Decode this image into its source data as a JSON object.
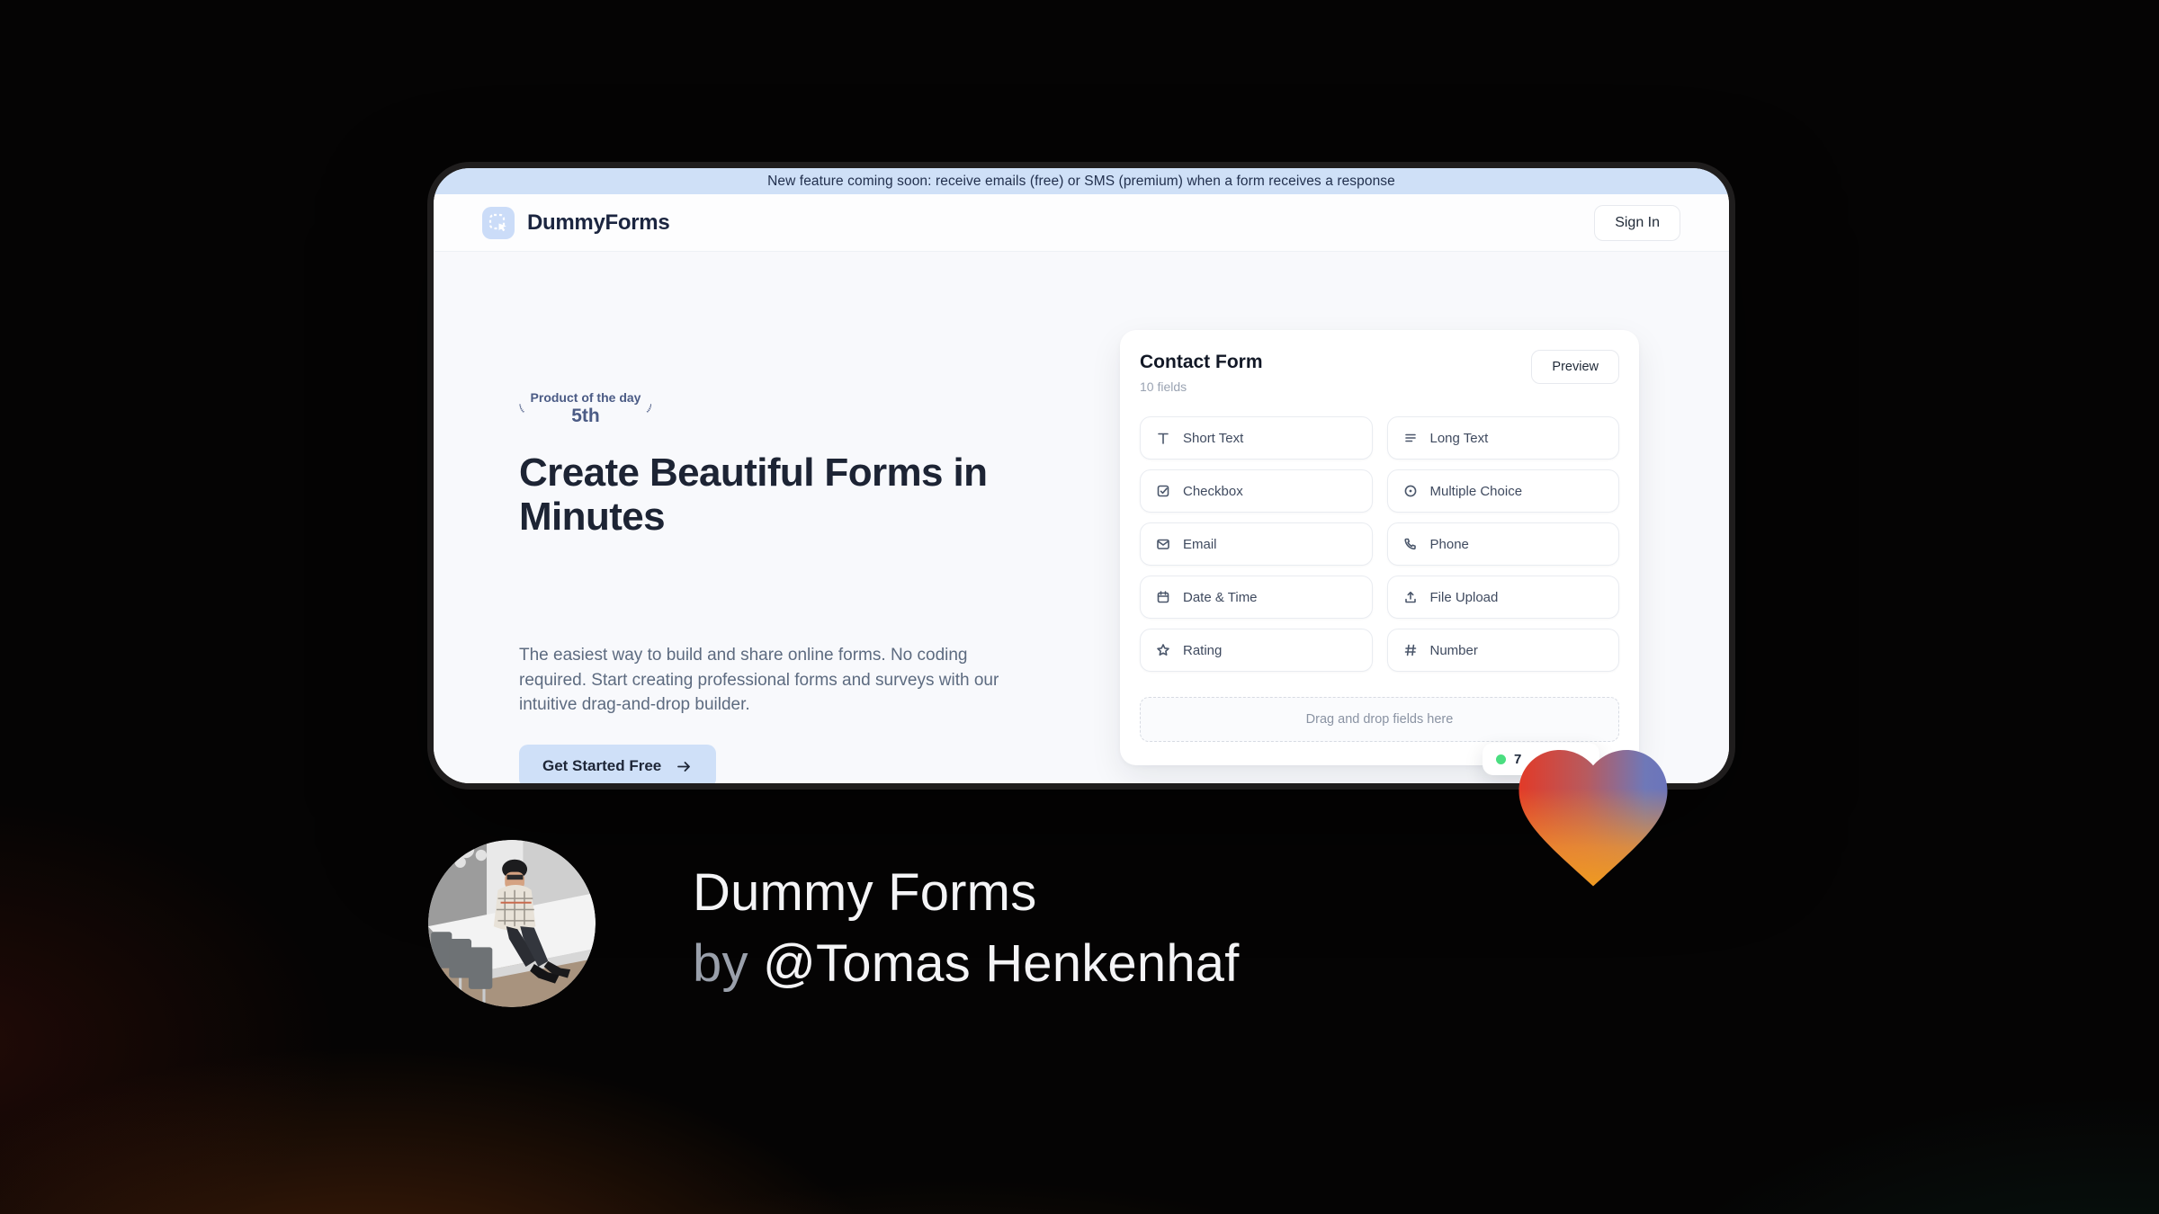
{
  "window": {
    "banner": "New feature coming soon: receive emails (free) or SMS (premium) when a form receives a response",
    "brand": "DummyForms",
    "sign_in_label": "Sign In"
  },
  "hero": {
    "award": {
      "line1": "Product of the day",
      "line2": "5th"
    },
    "headline": "Create Beautiful Forms in Minutes",
    "description": "The easiest way to build and share online forms. No coding required. Start creating professional forms and surveys with our intuitive drag-and-drop builder.",
    "cta_label": "Get Started Free"
  },
  "form_panel": {
    "title": "Contact Form",
    "subtitle": "10 fields",
    "preview_label": "Preview",
    "fields": [
      {
        "label": "Short Text",
        "icon": "short-text-icon"
      },
      {
        "label": "Long Text",
        "icon": "long-text-icon"
      },
      {
        "label": "Checkbox",
        "icon": "checkbox-icon"
      },
      {
        "label": "Multiple Choice",
        "icon": "radio-icon"
      },
      {
        "label": "Email",
        "icon": "envelope-icon"
      },
      {
        "label": "Phone",
        "icon": "phone-icon"
      },
      {
        "label": "Date & Time",
        "icon": "calendar-icon"
      },
      {
        "label": "File Upload",
        "icon": "upload-icon"
      },
      {
        "label": "Rating",
        "icon": "star-icon"
      },
      {
        "label": "Number",
        "icon": "hash-icon"
      }
    ],
    "dropzone_text": "Drag and drop fields here",
    "live_badge": {
      "text": "7",
      "dot_color": "#4ade80"
    }
  },
  "footer": {
    "title": "Dummy Forms",
    "byline_prefix": "by",
    "byline_author": "@Tomas Henkenhaf"
  },
  "colors": {
    "accent_blue": "#cfe0f8",
    "banner_bg": "#cfe0f7",
    "brand_navy": "#1b2540",
    "award_slate": "#4b5b85",
    "live_dot_green": "#4ade80",
    "heart_red": "#e23a28",
    "heart_blue": "#6b74bb",
    "heart_orange": "#ef9a20"
  }
}
